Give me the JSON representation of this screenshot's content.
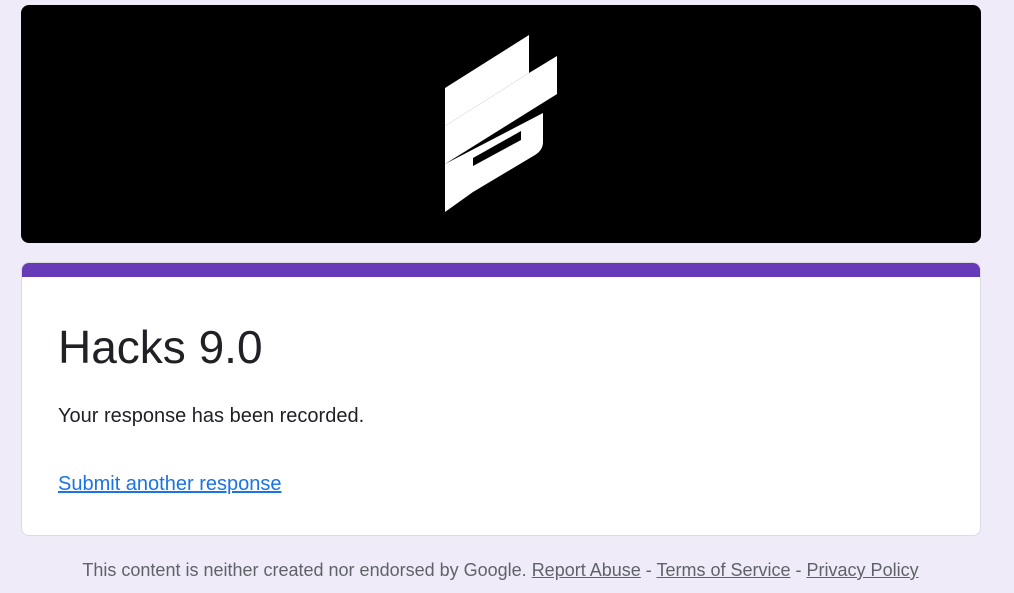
{
  "banner": {
    "logo_icon": "stylized-z-logo-icon",
    "background_color": "#000000",
    "logo_color": "#ffffff"
  },
  "form": {
    "title": "Hacks 9.0",
    "confirmation_message": "Your response has been recorded.",
    "submit_another_label": "Submit another response",
    "accent_color": "#673ab7",
    "link_color": "#1a73e8"
  },
  "footer": {
    "disclaimer": "This content is neither created nor endorsed by Google.",
    "separator": "-",
    "report_abuse_label": "Report Abuse",
    "terms_label": "Terms of Service",
    "privacy_label": "Privacy Policy"
  },
  "page": {
    "background_color": "#f0ebf8"
  }
}
